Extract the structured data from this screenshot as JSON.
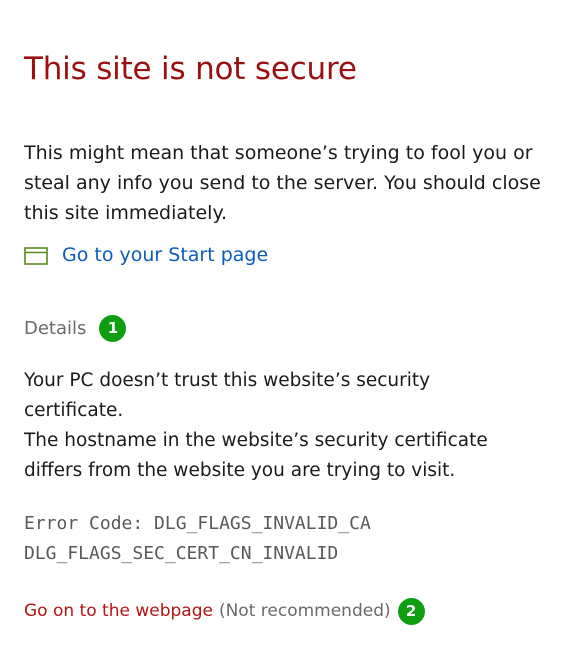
{
  "page": {
    "title": "This site is not secure",
    "warning_text": "This might mean that someone’s trying to fool you or steal any info you send to the server. You should close this site immediately."
  },
  "start_link": {
    "icon": "browser-window-icon",
    "label": "Go to your Start page",
    "icon_color": "#5a8a1e"
  },
  "details": {
    "label": "Details",
    "badge": "1",
    "lines": [
      "Your PC doesn’t trust this website’s security",
      "certificate.",
      "The hostname in the website’s security certificate",
      "differs from the website you are trying to visit."
    ],
    "error_code_lines": [
      "Error Code: DLG_FLAGS_INVALID_CA",
      "DLG_FLAGS_SEC_CERT_CN_INVALID"
    ]
  },
  "proceed": {
    "link_label": "Go on to the webpage",
    "note": "(Not recommended)",
    "badge": "2"
  },
  "colors": {
    "title": "#9b1010",
    "link_blue": "#0b5cbd",
    "proceed_red": "#b31414",
    "badge_green": "#0d9e12",
    "muted_gray": "#6a6a6a"
  }
}
